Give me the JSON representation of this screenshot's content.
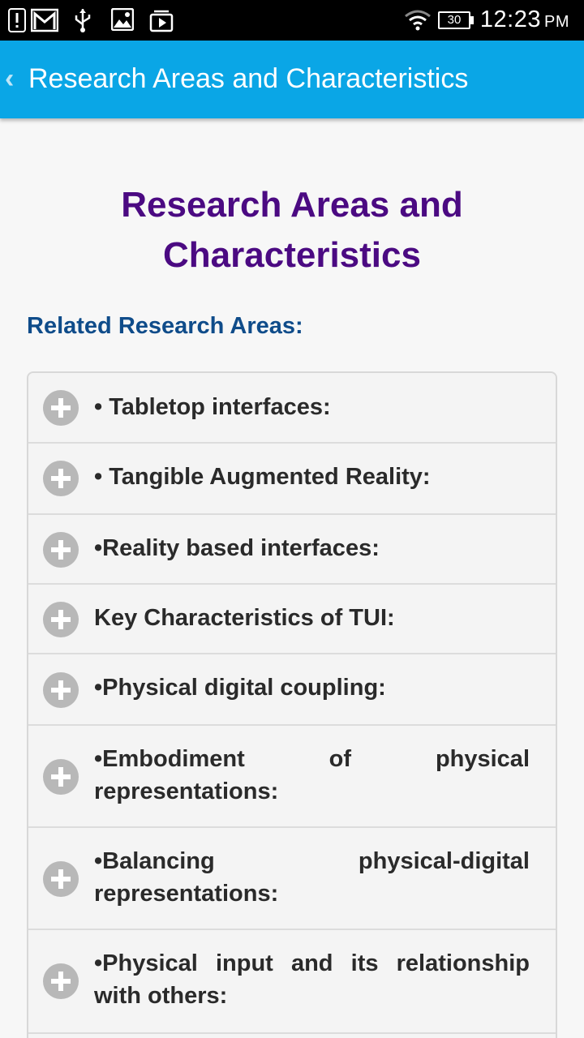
{
  "status_bar": {
    "time": "12:23",
    "ampm": "PM",
    "battery": "30",
    "icons": [
      "alert-icon",
      "gmail-icon",
      "usb-icon",
      "image-icon",
      "media-icon",
      "wifi-icon",
      "battery-icon"
    ]
  },
  "app_bar": {
    "back_glyph": "‹",
    "title": "Research Areas and Characteristics",
    "color": "#0aa6e6"
  },
  "page": {
    "title": "Research Areas and Characteristics",
    "section_heading": "Related Research Areas:"
  },
  "accordion": {
    "items": [
      {
        "label": "• Tabletop interfaces:"
      },
      {
        "label": "• Tangible Augmented Reality:"
      },
      {
        "label": "•Reality based interfaces:"
      },
      {
        "label": "Key Characteristics of TUI:"
      },
      {
        "label": "•Physical digital coupling:"
      },
      {
        "label": "•Embodiment of physical representations:"
      },
      {
        "label": "•Balancing physical-digital representations:"
      },
      {
        "label": "•Physical input and its relationship with others:"
      },
      {
        "label": ""
      }
    ]
  },
  "colors": {
    "title": "#4b0a82",
    "section_heading": "#0f4c8a",
    "plus_icon": "#b8b8b8"
  }
}
